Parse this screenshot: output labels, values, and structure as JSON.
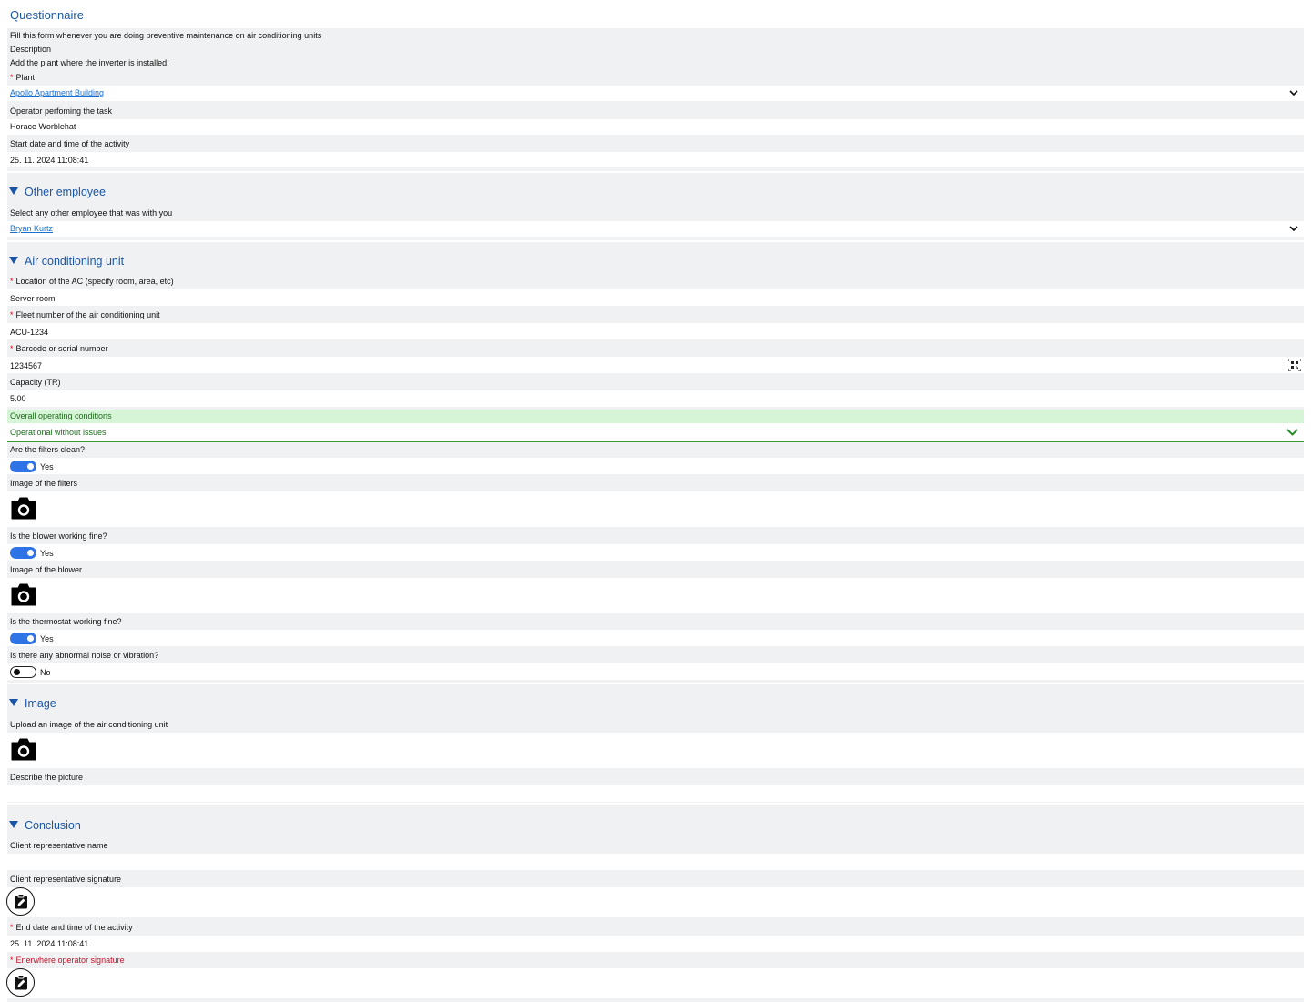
{
  "header": {
    "title": "Questionnaire",
    "intro": "Fill this form whenever you are doing preventive maintenance on air conditioning units",
    "description_label": "Description",
    "description_text": "Add the plant where the inverter is installed."
  },
  "general": {
    "plant_label": "Plant",
    "plant_value": "Apollo Apartment Building",
    "operator_label": "Operator perfoming the task",
    "operator_value": "Horace Worblehat",
    "start_label": "Start date and time of the activity",
    "start_value": "25. 11. 2024 11:08:41"
  },
  "other_employee": {
    "title": "Other employee",
    "select_label": "Select any other employee that was with you",
    "select_value": "Bryan Kurtz"
  },
  "ac_unit": {
    "title": "Air conditioning unit",
    "location_label": "Location of the AC (specify room, area, etc)",
    "location_value": "Server room",
    "fleet_label": "Fleet number of the air conditioning unit",
    "fleet_value": "ACU-1234",
    "barcode_label": "Barcode or serial number",
    "barcode_value": "1234567",
    "capacity_label": "Capacity (TR)",
    "capacity_value": "5.00",
    "conditions_label": "Overall operating conditions",
    "conditions_value": "Operational without issues",
    "filters_label": "Are the filters clean?",
    "filters_value": "Yes",
    "filters_image_label": "Image of the filters",
    "blower_label": "Is the blower working fine?",
    "blower_value": "Yes",
    "blower_image_label": "Image of the blower",
    "thermostat_label": "Is the thermostat working fine?",
    "thermostat_value": "Yes",
    "noise_label": "Is there any abnormal noise or vibration?",
    "noise_value": "No"
  },
  "image_section": {
    "title": "Image",
    "upload_label": "Upload an image of the air conditioning unit",
    "describe_label": "Describe the picture",
    "describe_value": ""
  },
  "conclusion": {
    "title": "Conclusion",
    "client_name_label": "Client representative name",
    "client_name_value": "",
    "client_signature_label": "Client representative signature",
    "end_label": "End date and time of the activity",
    "end_value": "25. 11. 2024 11:08:41",
    "operator_signature_label": "Enerwhere operator signature"
  },
  "colors": {
    "accent": "#1a56a8",
    "link": "#1a6fd0",
    "required": "#d0021b",
    "toggle_on": "#2f74e6",
    "success_bg": "#d6f5d6",
    "success_text": "#1e6b1e"
  },
  "icons": {
    "dropdown": "chevron-down-icon",
    "camera": "camera-icon",
    "qr": "qr-code-icon",
    "signature": "clipboard-pen-icon",
    "section": "triangle-down-icon"
  }
}
